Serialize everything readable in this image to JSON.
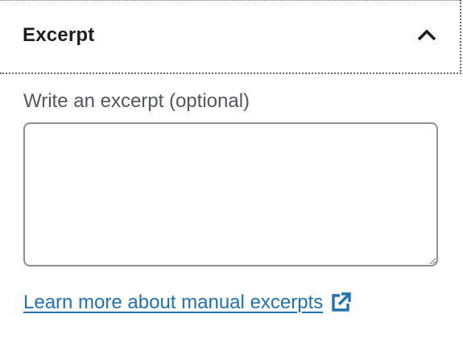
{
  "panel": {
    "title": "Excerpt",
    "toggle_icon": "chevron-up-icon",
    "expanded": true
  },
  "field": {
    "label": "Write an excerpt (optional)",
    "value": "",
    "placeholder": ""
  },
  "link": {
    "text": "Learn more about manual excerpts",
    "icon": "external-link-icon"
  },
  "colors": {
    "text": "#1e1e1e",
    "label": "#50575e",
    "link": "#2271b1",
    "border": "#8c8f94"
  }
}
